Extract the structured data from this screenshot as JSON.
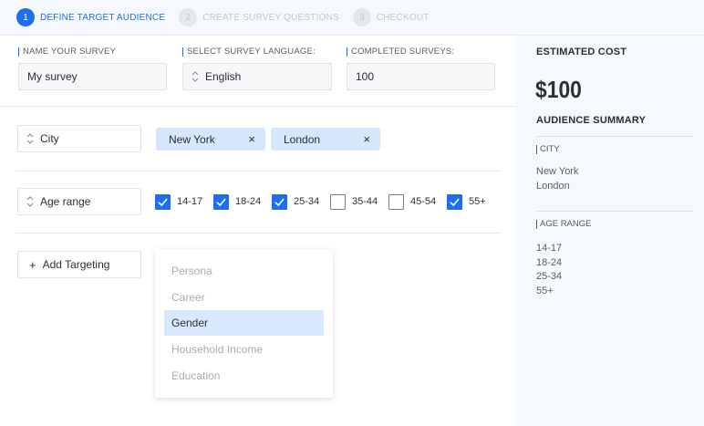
{
  "stepper": {
    "steps": [
      {
        "num": "1",
        "label": "DEFINE TARGET AUDIENCE"
      },
      {
        "num": "2",
        "label": "CREATE SURVEY QUESTIONS"
      },
      {
        "num": "3",
        "label": "CHECKOUT"
      }
    ]
  },
  "form": {
    "name": {
      "label": "NAME YOUR SURVEY",
      "value": "My survey"
    },
    "language": {
      "label": "SELECT SURVEY LANGUAGE:",
      "value": "English"
    },
    "completed": {
      "label": "COMPLETED SURVEYS:",
      "value": "100"
    }
  },
  "targeting": {
    "city": {
      "label": "City",
      "tags": [
        {
          "label": "New York",
          "remove": "×"
        },
        {
          "label": "London",
          "remove": "×"
        }
      ]
    },
    "age": {
      "label": "Age range",
      "options": [
        {
          "label": "14-17",
          "checked": true
        },
        {
          "label": "18-24",
          "checked": true
        },
        {
          "label": "25-34",
          "checked": true
        },
        {
          "label": "35-44",
          "checked": false
        },
        {
          "label": "45-54",
          "checked": false
        },
        {
          "label": "55+",
          "checked": true
        }
      ]
    },
    "add": {
      "icon": "+",
      "label": "Add Targeting"
    },
    "dropdown": {
      "items": [
        "Persona",
        "Career",
        "Gender",
        "Household Income",
        "Education"
      ],
      "selected": "Gender"
    }
  },
  "summary": {
    "estimated_title": "ESTIMATED COST",
    "estimated_value": "$100",
    "audience_title": "AUDIENCE SUMMARY",
    "city_label": "CITY",
    "cities": [
      "New York",
      "London"
    ],
    "age_label": "AGE RANGE",
    "ages": [
      "14-17",
      "18-24",
      "25-34",
      "55+"
    ]
  },
  "colors": {
    "accent": "#1e6ff0",
    "tag_bg": "#d6e6fb",
    "panel_bg": "#f5f8fc"
  }
}
